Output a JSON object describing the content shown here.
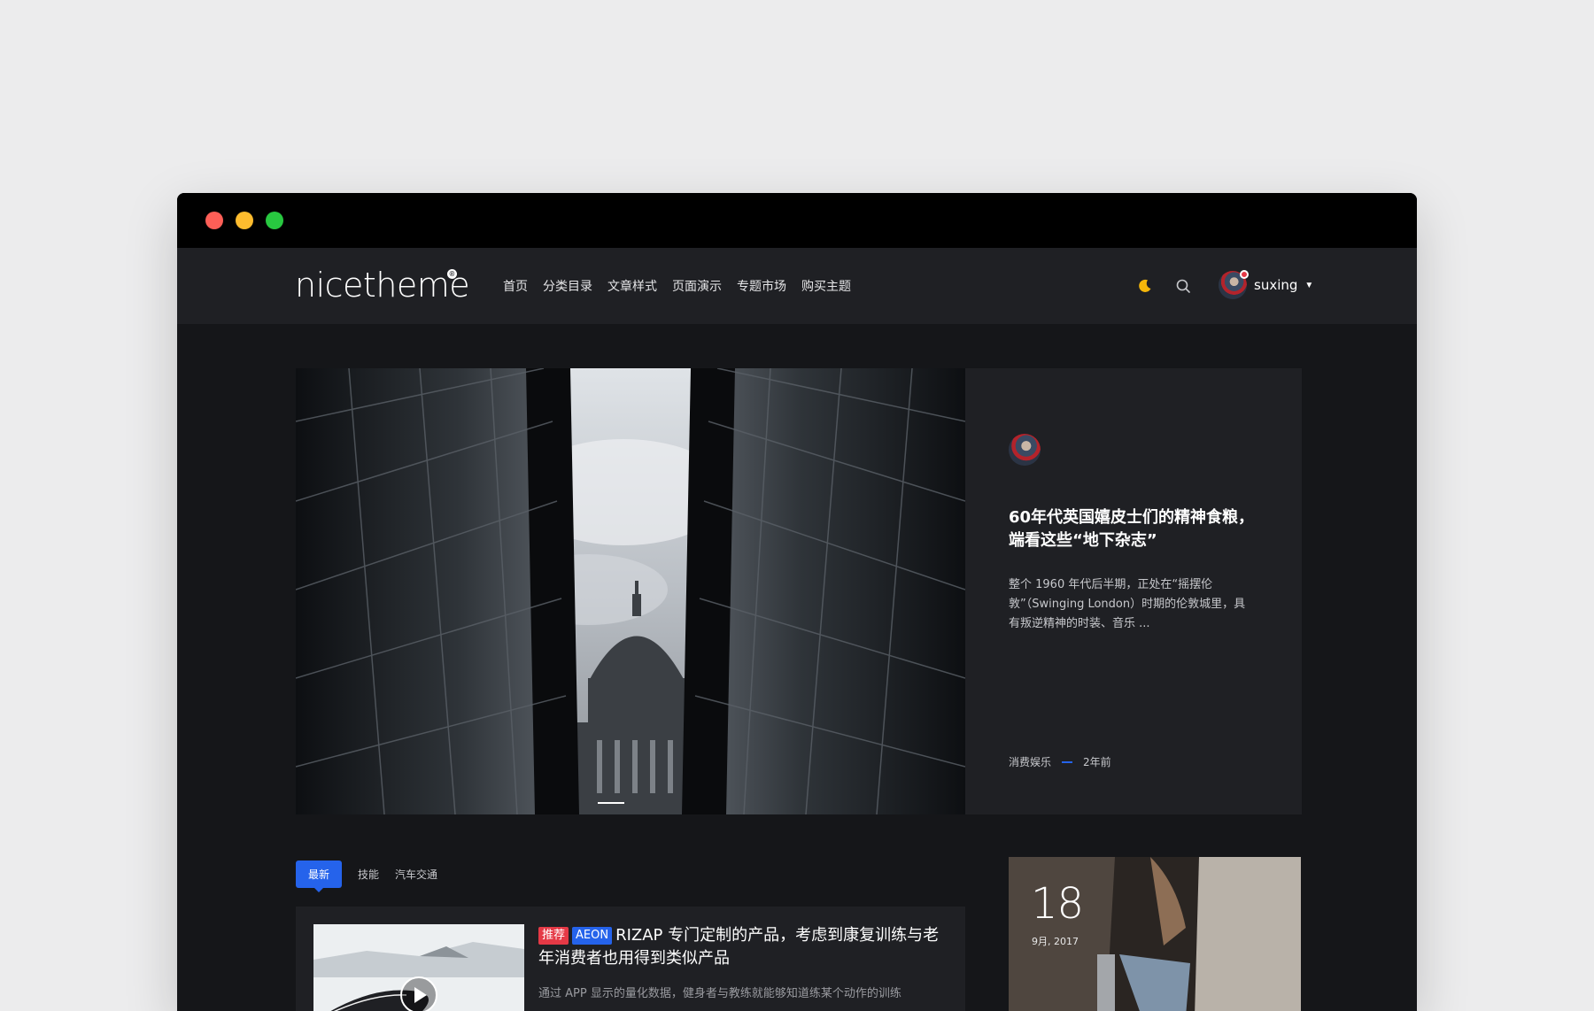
{
  "window": {
    "controls": [
      "close",
      "minimize",
      "maximize"
    ]
  },
  "nav": {
    "logo": "nicetheme",
    "logo_mark": "®",
    "links": [
      "首页",
      "分类目录",
      "文章样式",
      "页面演示",
      "专题市场",
      "购买主题"
    ],
    "user_name": "suxing",
    "icons": [
      "moon-icon",
      "search-icon",
      "caret-down-icon"
    ]
  },
  "hero": {
    "title": "60年代英国嬉皮士们的精神食粮，端看这些“地下杂志”",
    "excerpt": "整个 1960 年代后半期，正处在“摇摆伦敦”（Swinging London）时期的伦敦城里，具有叛逆精神的时装、音乐 ...",
    "category": "消费娱乐",
    "time": "2年前"
  },
  "tabs": [
    "最新",
    "技能",
    "汽车交通"
  ],
  "post": {
    "tag1": "推荐",
    "tag2": "AEON",
    "title": "RIZAP 专门定制的产品，考虑到康复训练与老年消费者也用得到类似产品",
    "excerpt": "通过 APP 显示的量化数据，健身者与教练就能够知道练某个动作的训练"
  },
  "side": {
    "day": "18",
    "month_year": "9月, 2017"
  },
  "colors": {
    "accent": "#2563eb",
    "tag_red": "#e53946",
    "moon": "#f5b70a"
  }
}
